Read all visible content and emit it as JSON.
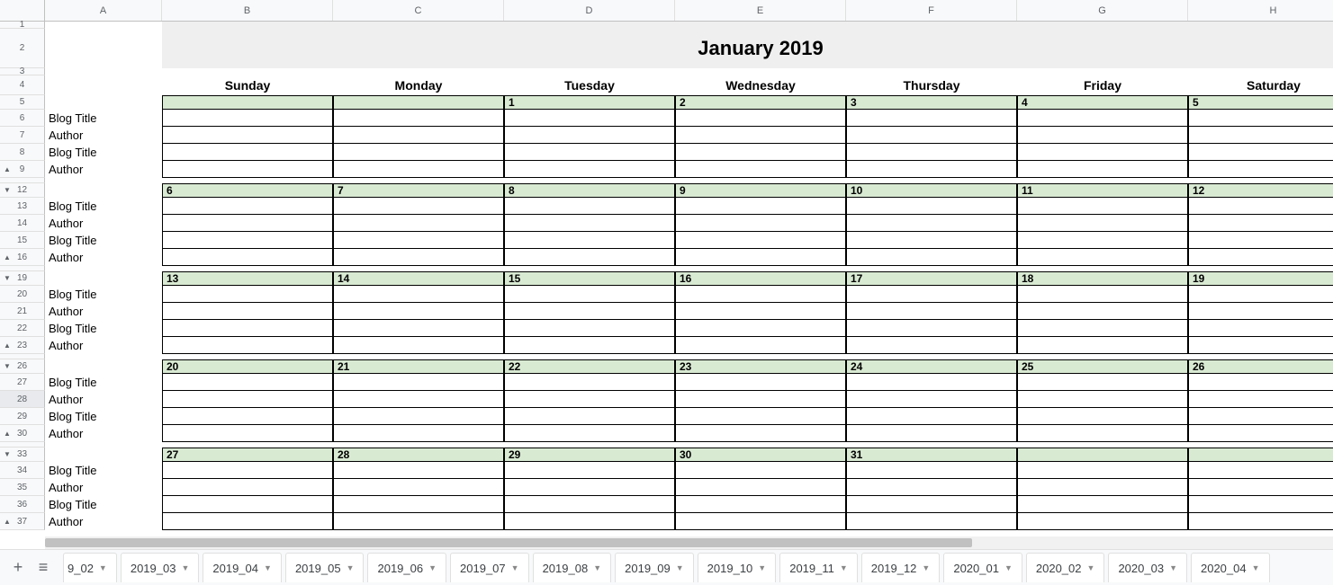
{
  "columns": [
    "A",
    "B",
    "C",
    "D",
    "E",
    "F",
    "G",
    "H"
  ],
  "title": "January 2019",
  "dow": [
    "Sunday",
    "Monday",
    "Tuesday",
    "Wednesday",
    "Thursday",
    "Friday",
    "Saturday"
  ],
  "row_labels": [
    "Blog Title",
    "Author",
    "Blog Title",
    "Author"
  ],
  "weeks": [
    {
      "row_num": "5",
      "dates": [
        "",
        "",
        "1",
        "2",
        "3",
        "4",
        "5"
      ],
      "data_rows": [
        "6",
        "7",
        "8",
        "9"
      ],
      "collapse_up_row": "9",
      "collapse_down_row": "12"
    },
    {
      "row_num": "12",
      "dates": [
        "6",
        "7",
        "8",
        "9",
        "10",
        "11",
        "12"
      ],
      "data_rows": [
        "13",
        "14",
        "15",
        "16"
      ],
      "collapse_up_row": "16",
      "collapse_down_row": "19"
    },
    {
      "row_num": "19",
      "dates": [
        "13",
        "14",
        "15",
        "16",
        "17",
        "18",
        "19"
      ],
      "data_rows": [
        "20",
        "21",
        "22",
        "23"
      ],
      "collapse_up_row": "23",
      "collapse_down_row": "26"
    },
    {
      "row_num": "26",
      "dates": [
        "20",
        "21",
        "22",
        "23",
        "24",
        "25",
        "26"
      ],
      "data_rows": [
        "27",
        "28",
        "29",
        "30"
      ],
      "collapse_up_row": "30",
      "collapse_down_row": "33"
    },
    {
      "row_num": "33",
      "dates": [
        "27",
        "28",
        "29",
        "30",
        "31",
        "",
        ""
      ],
      "data_rows": [
        "34",
        "35",
        "36",
        "37"
      ],
      "collapse_up_row": "37",
      "collapse_down_row": null
    }
  ],
  "header_rows": {
    "r1": "1",
    "r2": "2",
    "r3": "3",
    "r4": "4"
  },
  "selected_row": "28",
  "tabs_partial_first": "9_02",
  "tabs": [
    "2019_03",
    "2019_04",
    "2019_05",
    "2019_06",
    "2019_07",
    "2019_08",
    "2019_09",
    "2019_10",
    "2019_11",
    "2019_12",
    "2020_01",
    "2020_02",
    "2020_03",
    "2020_04"
  ]
}
